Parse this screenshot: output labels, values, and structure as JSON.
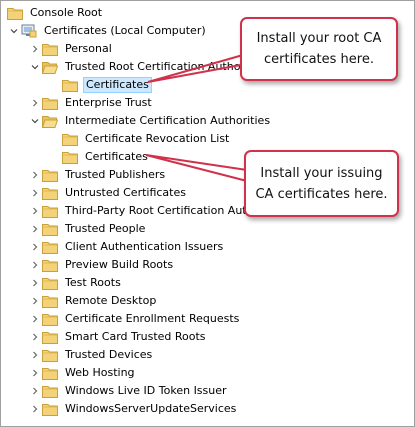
{
  "tree": {
    "root": "Console Root",
    "store": "Certificates (Local Computer)",
    "items": [
      "Personal",
      "Trusted Root Certification Authorities",
      "Certificates",
      "Enterprise Trust",
      "Intermediate Certification Authorities",
      "Certificate Revocation List",
      "Certificates",
      "Trusted Publishers",
      "Untrusted Certificates",
      "Third-Party Root Certification Authorities",
      "Trusted People",
      "Client Authentication Issuers",
      "Preview Build Roots",
      "Test Roots",
      "Remote Desktop",
      "Certificate Enrollment Requests",
      "Smart Card Trusted Roots",
      "Trusted Devices",
      "Web Hosting",
      "Windows Live ID Token Issuer",
      "WindowsServerUpdateServices"
    ]
  },
  "callouts": {
    "root_ca": "Install your root CA certificates here.",
    "issuing_ca": "Install your issuing CA certificates here."
  },
  "colors": {
    "callout_border": "#d0324b",
    "selection_bg": "#cce8ff",
    "folder": "#f3d27a"
  }
}
